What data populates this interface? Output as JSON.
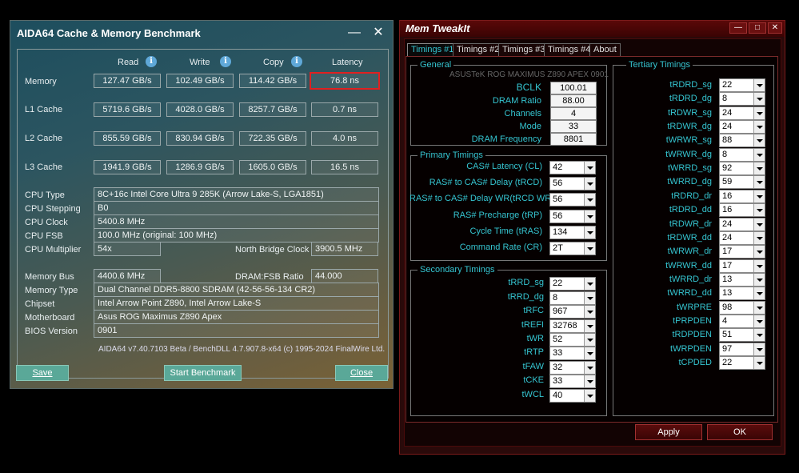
{
  "aida": {
    "title": "AIDA64 Cache & Memory Benchmark",
    "columns": [
      "Read",
      "Write",
      "Copy",
      "Latency"
    ],
    "bench_rows": [
      {
        "label": "Memory",
        "read": "127.47 GB/s",
        "write": "102.49 GB/s",
        "copy": "114.42 GB/s",
        "latency": "76.8 ns"
      },
      {
        "label": "L1 Cache",
        "read": "5719.6 GB/s",
        "write": "4028.0 GB/s",
        "copy": "8257.7 GB/s",
        "latency": "0.7 ns"
      },
      {
        "label": "L2 Cache",
        "read": "855.59 GB/s",
        "write": "830.94 GB/s",
        "copy": "722.35 GB/s",
        "latency": "4.0 ns"
      },
      {
        "label": "L3 Cache",
        "read": "1941.9 GB/s",
        "write": "1286.9 GB/s",
        "copy": "1605.0 GB/s",
        "latency": "16.5 ns"
      }
    ],
    "cpu_type_label": "CPU Type",
    "cpu_type": "8C+16c Intel Core Ultra 9 285K  (Arrow Lake-S, LGA1851)",
    "cpu_stepping_label": "CPU Stepping",
    "cpu_stepping": "B0",
    "cpu_clock_label": "CPU Clock",
    "cpu_clock": "5400.8 MHz",
    "cpu_fsb_label": "CPU FSB",
    "cpu_fsb": "100.0 MHz  (original: 100 MHz)",
    "cpu_mult_label": "CPU Multiplier",
    "cpu_mult": "54x",
    "nb_clock_label": "North Bridge Clock",
    "nb_clock": "3900.5 MHz",
    "mem_bus_label": "Memory Bus",
    "mem_bus": "4400.6 MHz",
    "dram_fsb_label": "DRAM:FSB Ratio",
    "dram_fsb": "44.000",
    "mem_type_label": "Memory Type",
    "mem_type": "Dual Channel DDR5-8800 SDRAM  (42-56-56-134 CR2)",
    "chipset_label": "Chipset",
    "chipset": "Intel Arrow Point Z890, Intel Arrow Lake-S",
    "mobo_label": "Motherboard",
    "mobo": "Asus ROG Maximus Z890 Apex",
    "bios_label": "BIOS Version",
    "bios": "0901",
    "copyright": "AIDA64 v7.40.7103 Beta / BenchDLL 4.7.907.8-x64  (c) 1995-2024 FinalWire Ltd.",
    "save_label": "Save",
    "start_label": "Start Benchmark",
    "close_label": "Close"
  },
  "mti": {
    "title": "Mem TweakIt",
    "tabs": [
      "Timings #1",
      "Timings #2",
      "Timings #3",
      "Timings #4",
      "About"
    ],
    "general_title": "General",
    "board": "ASUSTeK ROG MAXIMUS Z890 APEX 0901",
    "general": [
      {
        "label": "BCLK",
        "value": "100.01"
      },
      {
        "label": "DRAM Ratio",
        "value": "88.00"
      },
      {
        "label": "Channels",
        "value": "4"
      },
      {
        "label": "Mode",
        "value": "33"
      },
      {
        "label": "DRAM Frequency",
        "value": "8801"
      }
    ],
    "primary_title": "Primary Timings",
    "primary": [
      {
        "label": "CAS# Latency (CL)",
        "value": "42"
      },
      {
        "label": "RAS# to CAS# Delay (tRCD)",
        "value": "56"
      },
      {
        "label": "RAS# to CAS# Delay WR(tRCD WR)",
        "value": "56"
      },
      {
        "label": "RAS# Precharge (tRP)",
        "value": "56"
      },
      {
        "label": "Cycle Time (tRAS)",
        "value": "134"
      },
      {
        "label": "Command Rate (CR)",
        "value": "2T"
      }
    ],
    "secondary_title": "Secondary Timings",
    "secondary": [
      {
        "label": "tRRD_sg",
        "value": "22"
      },
      {
        "label": "tRRD_dg",
        "value": "8"
      },
      {
        "label": "tRFC",
        "value": "967"
      },
      {
        "label": "tREFI",
        "value": "32768"
      },
      {
        "label": "tWR",
        "value": "52"
      },
      {
        "label": "tRTP",
        "value": "33"
      },
      {
        "label": "tFAW",
        "value": "32"
      },
      {
        "label": "tCKE",
        "value": "33"
      },
      {
        "label": "tWCL",
        "value": "40"
      }
    ],
    "tertiary_title": "Tertiary Timings",
    "tertiary": [
      {
        "label": "tRDRD_sg",
        "value": "22"
      },
      {
        "label": "tRDRD_dg",
        "value": "8"
      },
      {
        "label": "tRDWR_sg",
        "value": "24"
      },
      {
        "label": "tRDWR_dg",
        "value": "24"
      },
      {
        "label": "tWRWR_sg",
        "value": "88"
      },
      {
        "label": "tWRWR_dg",
        "value": "8"
      },
      {
        "label": "tWRRD_sg",
        "value": "92"
      },
      {
        "label": "tWRRD_dg",
        "value": "59"
      },
      {
        "label": "tRDRD_dr",
        "value": "16"
      },
      {
        "label": "tRDRD_dd",
        "value": "16"
      },
      {
        "label": "tRDWR_dr",
        "value": "24"
      },
      {
        "label": "tRDWR_dd",
        "value": "24"
      },
      {
        "label": "tWRWR_dr",
        "value": "17"
      },
      {
        "label": "tWRWR_dd",
        "value": "17"
      },
      {
        "label": "tWRRD_dr",
        "value": "13"
      },
      {
        "label": "tWRRD_dd",
        "value": "13"
      },
      {
        "label": "tWRPRE",
        "value": "98"
      },
      {
        "label": "tPRPDEN",
        "value": "4"
      },
      {
        "label": "tRDPDEN",
        "value": "51"
      },
      {
        "label": "tWRPDEN",
        "value": "97"
      },
      {
        "label": "tCPDED",
        "value": "22"
      }
    ],
    "apply_label": "Apply",
    "ok_label": "OK"
  }
}
